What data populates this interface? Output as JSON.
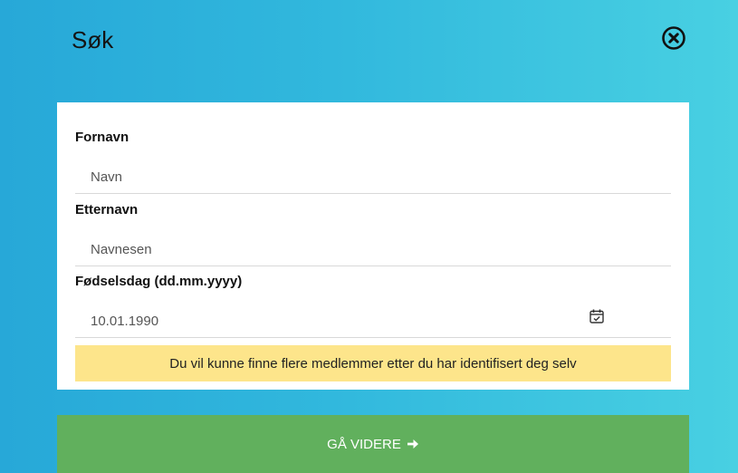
{
  "modal": {
    "title": "Søk",
    "close_icon": "close-circle-icon"
  },
  "form": {
    "first_name": {
      "label": "Fornavn",
      "placeholder": "Navn",
      "value": ""
    },
    "last_name": {
      "label": "Etternavn",
      "placeholder": "Navnesen",
      "value": ""
    },
    "birthday": {
      "label": "Fødselsdag (dd.mm.yyyy)",
      "placeholder": "10.01.1990",
      "value": "",
      "icon": "calendar-check-icon"
    },
    "notice": "Du vil kunne finne flere medlemmer etter du har identifisert deg selv"
  },
  "footer": {
    "continue_label": "GÅ VIDERE",
    "continue_icon": "arrow-right-icon"
  },
  "colors": {
    "background_start": "#27a8d8",
    "background_end": "#48d0e2",
    "notice_bg": "#fde58b",
    "button_bg": "#61b05d"
  }
}
